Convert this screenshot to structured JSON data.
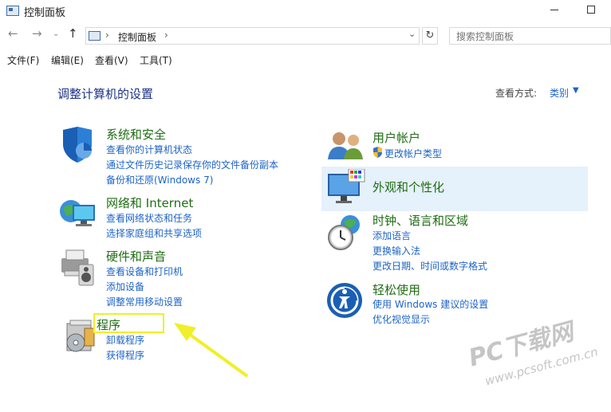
{
  "window": {
    "title": "控制面板"
  },
  "address": {
    "crumb": "控制面板",
    "search_placeholder": "搜索控制面板"
  },
  "menu": [
    "文件(F)",
    "编辑(E)",
    "查看(V)",
    "工具(T)"
  ],
  "page": {
    "heading": "调整计算机的设置",
    "view_by_label": "查看方式:",
    "view_by_value": "类别"
  },
  "categories": {
    "system": {
      "title": "系统和安全",
      "links": [
        "查看你的计算机状态",
        "通过文件历史记录保存你的文件备份副本",
        "备份和还原(Windows 7)"
      ]
    },
    "network": {
      "title": "网络和 Internet",
      "links": [
        "查看网络状态和任务",
        "选择家庭组和共享选项"
      ]
    },
    "hardware": {
      "title": "硬件和声音",
      "links": [
        "查看设备和打印机",
        "添加设备",
        "调整常用移动设置"
      ]
    },
    "programs": {
      "title": "程序",
      "links": [
        "卸载程序",
        "获得程序"
      ]
    },
    "users": {
      "title": "用户帐户",
      "links": [
        "更改帐户类型"
      ]
    },
    "appearance": {
      "title": "外观和个性化",
      "links": []
    },
    "clock": {
      "title": "时钟、语言和区域",
      "links": [
        "添加语言",
        "更换输入法",
        "更改日期、时间或数字格式"
      ]
    },
    "access": {
      "title": "轻松使用",
      "links": [
        "使用 Windows 建议的设置",
        "优化视觉显示"
      ]
    }
  },
  "watermark": {
    "line1": "PC下载网",
    "line2": "www.pcsoft.com.cn"
  },
  "colors": {
    "link": "#1e64c8",
    "category_title": "#1f6d14",
    "heading": "#1e3287",
    "hover": "#e5f1fb",
    "annotation": "#f0ef2a"
  }
}
